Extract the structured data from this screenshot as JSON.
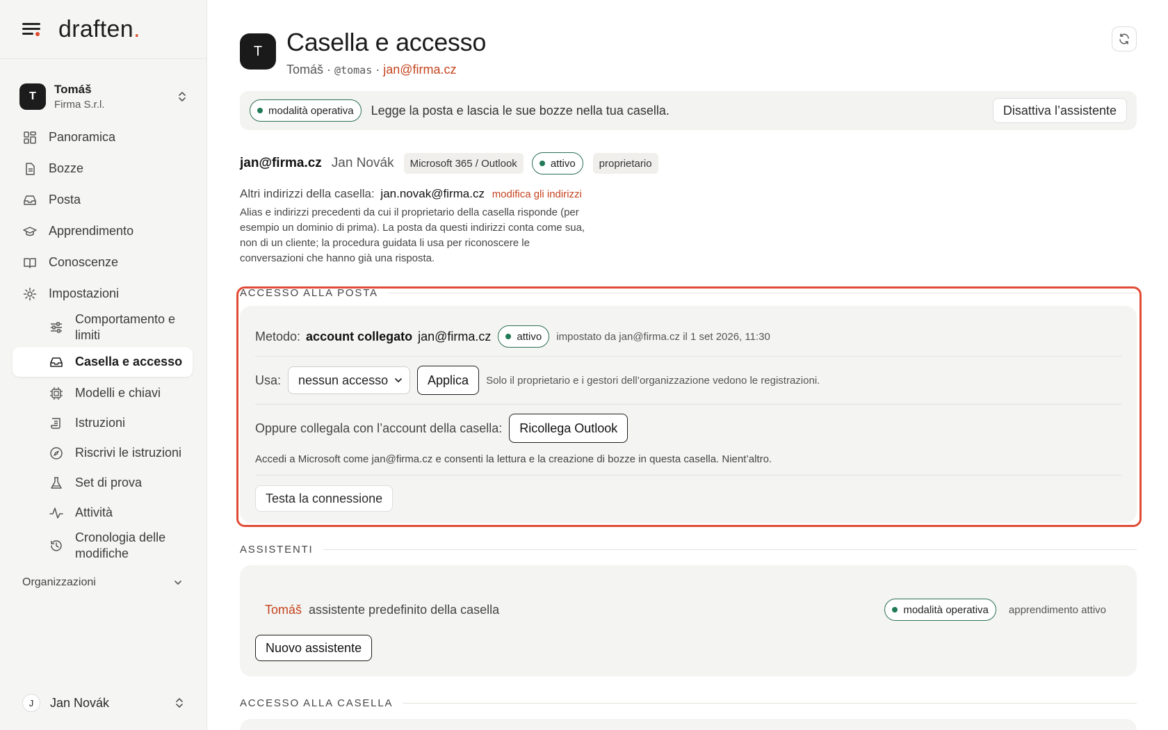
{
  "brand": {
    "name": "draften",
    "dot": "."
  },
  "sidebar": {
    "org": {
      "initial": "T",
      "name": "Tomáš",
      "company": "Firma S.r.l."
    },
    "nav": [
      {
        "label": "Panoramica",
        "icon": "grid-icon"
      },
      {
        "label": "Bozze",
        "icon": "document-icon"
      },
      {
        "label": "Posta",
        "icon": "inbox-icon"
      },
      {
        "label": "Apprendimento",
        "icon": "graduation-cap-icon"
      },
      {
        "label": "Conoscenze",
        "icon": "book-icon"
      },
      {
        "label": "Impostazioni",
        "icon": "gear-icon"
      }
    ],
    "sub": [
      {
        "label": "Comportamento e limiti",
        "icon": "sliders-icon"
      },
      {
        "label": "Casella e accesso",
        "icon": "inbox-icon",
        "active": true
      },
      {
        "label": "Modelli e chiavi",
        "icon": "chip-icon"
      },
      {
        "label": "Istruzioni",
        "icon": "scroll-icon"
      },
      {
        "label": "Riscrivi le istruzioni",
        "icon": "compass-icon"
      },
      {
        "label": "Set di prova",
        "icon": "flask-icon"
      },
      {
        "label": "Attività",
        "icon": "activity-icon"
      },
      {
        "label": "Cronologia delle modifiche",
        "icon": "history-icon"
      }
    ],
    "orgs_label": "Organizzazioni",
    "user": {
      "initial": "J",
      "name": "Jan Novák"
    }
  },
  "header": {
    "initial": "T",
    "title": "Casella e accesso",
    "owner": "Tomáš",
    "sep1": "·",
    "handle": "@tomas",
    "sep2": "·",
    "email": "jan@firma.cz"
  },
  "banner": {
    "mode": "modalità operativa",
    "text": "Legge la posta e lascia le sue bozze nella tua casella.",
    "button": "Disattiva l’assistente"
  },
  "mailbox": {
    "email": "jan@firma.cz",
    "person": "Jan Novák",
    "provider": "Microsoft 365 / Outlook",
    "status": "attivo",
    "role": "proprietario",
    "alt_label": "Altri indirizzi della casella:",
    "alt_value": "jan.novak@firma.cz",
    "alt_edit": "modifica gli indirizzi",
    "alt_desc": "Alias e indirizzi precedenti da cui il proprietario della casella risponde (per esempio un dominio di prima). La posta da questi indirizzi conta come sua, non di un cliente; la procedura guidata li usa per riconoscere le conversazioni che hanno già una risposta."
  },
  "mail_access": {
    "section_title": "ACCESSO ALLA POSTA",
    "method_label": "Metodo:",
    "method_value": "account collegato",
    "method_email": "jan@firma.cz",
    "method_status": "attivo",
    "method_meta": "impostato da jan@firma.cz il 1 set 2026, 11:30",
    "use_label": "Usa:",
    "use_selected": "nessun accesso",
    "apply": "Applica",
    "use_note": "Solo il proprietario e i gestori dell’organizzazione vedono le registrazioni.",
    "link_label": "Oppure collegala con l’account della casella:",
    "link_button": "Ricollega Outlook",
    "link_desc": "Accedi a Microsoft come jan@firma.cz e consenti la lettura e la creazione di bozze in questa casella. Nient’altro.",
    "test_button": "Testa la connessione"
  },
  "assistants": {
    "section_title": "ASSISTENTI",
    "name": "Tomáš",
    "desc": "assistente predefinito della casella",
    "mode": "modalità operativa",
    "learning": "apprendimento attivo",
    "new_button": "Nuovo assistente"
  },
  "mailbox_access": {
    "section_title": "ACCESSO ALLA CASELLA"
  },
  "colors": {
    "accent": "#e04a2f",
    "link": "#c4441f",
    "status_green": "#1f7a55",
    "focus_frame": "#e14b35"
  }
}
